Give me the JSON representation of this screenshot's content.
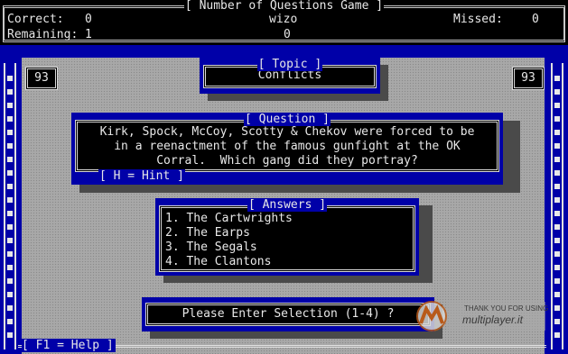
{
  "header": {
    "title": "[ Number of Questions Game ]",
    "correct_label": "Correct:",
    "correct_value": "0",
    "remaining_label": "Remaining:",
    "remaining_value": "1",
    "player_name": "wizo",
    "player_score": "0",
    "missed_label": "Missed:",
    "missed_value": "0"
  },
  "scores": {
    "left": "93",
    "right": "93"
  },
  "topic": {
    "title": "[ Topic ]",
    "value": "Conflicts"
  },
  "question": {
    "title": "[ Question ]",
    "lines": [
      "Kirk, Spock, McCoy, Scotty & Chekov were forced to be",
      "in a reenactment of the famous gunfight at the OK",
      "Corral.  Which gang did they portray?"
    ],
    "hint": "[ H = Hint ]"
  },
  "answers": {
    "title": "[ Answers ]",
    "items": [
      "1. The Cartwrights",
      "2. The Earps",
      "3. The Segals",
      "4. The Clantons"
    ]
  },
  "prompt": "Please Enter Selection (1-4) ?",
  "footer": "[ F1 = Help ]",
  "watermark": {
    "line1": "THANK YOU FOR USING",
    "line2": "multiplayer.it"
  },
  "colors": {
    "board_blue": "#0000a8",
    "gray": "#a8a8a8",
    "text": "#e8e8e8"
  }
}
